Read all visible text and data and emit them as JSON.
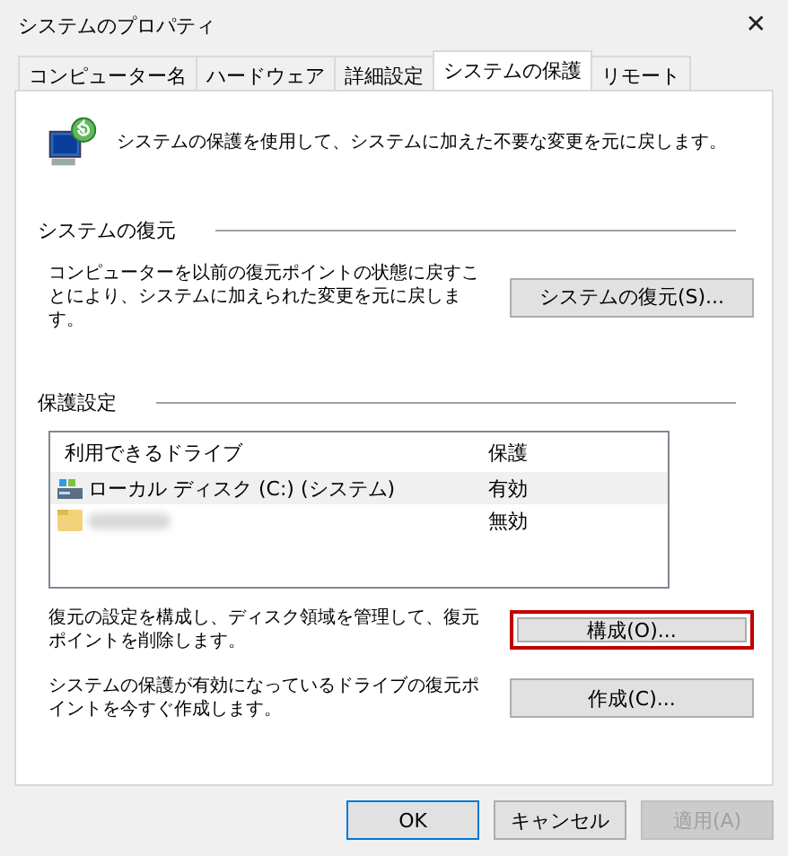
{
  "window": {
    "title": "システムのプロパティ",
    "close": "✕"
  },
  "tabs": [
    {
      "label": "コンピューター名",
      "selected": false
    },
    {
      "label": "ハードウェア",
      "selected": false
    },
    {
      "label": "詳細設定",
      "selected": false
    },
    {
      "label": "システムの保護",
      "selected": true
    },
    {
      "label": "リモート",
      "selected": false
    }
  ],
  "intro": "システムの保護を使用して、システムに加えた不要な変更を元に戻します。",
  "restore_group": {
    "title": "システムの復元",
    "description": "コンピューターを以前の復元ポイントの状態に戻すことにより、システムに加えられた変更を元に戻します。",
    "button": {
      "label": "システムの復元(S)...",
      "highlighted": false
    }
  },
  "protection_group": {
    "title": "保護設定",
    "drives": {
      "columns": [
        "利用できるドライブ",
        "保護"
      ],
      "rows": [
        {
          "kind": "system",
          "name": "ローカル ディスク (C:) (システム)",
          "protection": "有効",
          "selected": true
        },
        {
          "kind": "folder",
          "protection": "無効",
          "selected": false
        }
      ]
    },
    "actions": [
      {
        "description": "復元の設定を構成し、ディスク領域を管理して、復元ポイントを削除します。",
        "button": {
          "label": "構成(O)...",
          "highlighted": true
        }
      },
      {
        "description": "システムの保護が有効になっているドライブの復元ポイントを今すぐ作成します。",
        "button": {
          "label": "作成(C)...",
          "highlighted": false
        }
      }
    ]
  },
  "buttons": [
    {
      "label": "OK",
      "kind": "default",
      "disabled": false
    },
    {
      "label": "キャンセル",
      "kind": "normal",
      "disabled": false
    },
    {
      "label": "適用(A)",
      "kind": "normal",
      "disabled": true
    }
  ]
}
